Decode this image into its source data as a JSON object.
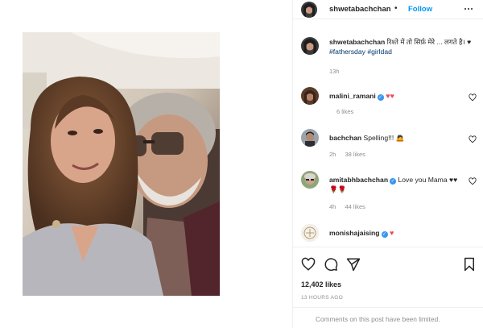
{
  "header": {
    "username": "shwetabachchan",
    "separator": "•",
    "follow_label": "Follow",
    "more_icon": "more-horizontal-icon"
  },
  "caption": {
    "username": "shwetabachchan",
    "text": "रिश्ते में तो सिर्फ़ मेरे ... लगते है। ♥",
    "hashtags": [
      "#fathersday",
      "#girldad"
    ],
    "time": "13h"
  },
  "comments": [
    {
      "username": "malini_ramani",
      "verified": true,
      "text": "♥♥",
      "time": "",
      "likes": "6 likes",
      "reply": ""
    },
    {
      "username": "bachchan",
      "verified": false,
      "text": "Spelling!!! 🙇",
      "time": "2h",
      "likes": "38 likes",
      "reply": ""
    },
    {
      "username": "amitabhbachchan",
      "verified": true,
      "text": "Love you Mama ♥♥🌹🌹",
      "time": "4h",
      "likes": "44 likes",
      "reply": ""
    },
    {
      "username": "monishajaising",
      "verified": true,
      "text": "♥",
      "time": "",
      "likes": "",
      "reply": ""
    }
  ],
  "actions": {
    "like_icon": "heart-outline-icon",
    "comment_icon": "comment-bubble-icon",
    "share_icon": "paper-plane-icon",
    "save_icon": "bookmark-icon"
  },
  "likes_count": "12,402 likes",
  "post_time": "13 HOURS AGO",
  "comments_notice": "Comments on this post have been limited.",
  "colors": {
    "follow_blue": "#0095f6",
    "hashtag": "#00376b",
    "heart_red": "#ed4956",
    "muted": "#8e8e8e"
  }
}
